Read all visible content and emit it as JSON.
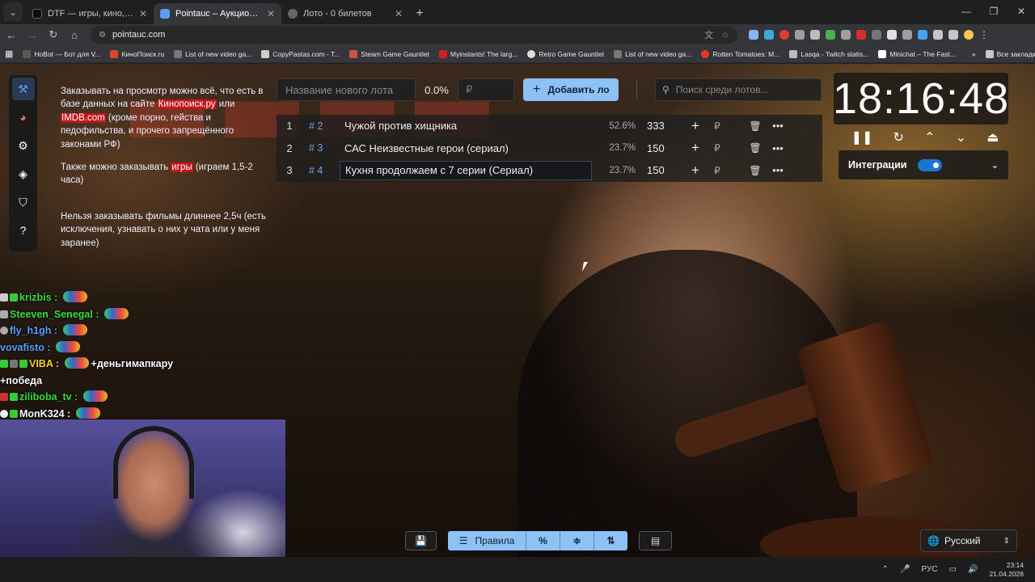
{
  "browser": {
    "tabs": [
      {
        "title": "DTF — игры, кино, сериалы, р",
        "active": false,
        "favicon_color": "#0d0d0d"
      },
      {
        "title": "Pointauc – Аукционы, лотере",
        "active": true,
        "favicon_color": "#5b9cff"
      },
      {
        "title": "Лото - 0 билетов",
        "active": false,
        "favicon_color": "#888888"
      }
    ],
    "url": "pointauc.com",
    "bookmarks": [
      {
        "label": "HoBot — Бот для V...",
        "color": "#5a5a5a"
      },
      {
        "label": "КиноПоиск.ru",
        "color": "#d94820"
      },
      {
        "label": "List of new video ga...",
        "color": "#777777"
      },
      {
        "label": "CopyPastas.com - T...",
        "color": "#cccccc"
      },
      {
        "label": "Steam Game Gauntlet",
        "color": "#c8553d"
      },
      {
        "label": "Myinstants! The larg...",
        "color": "#cc2222"
      },
      {
        "label": "Retro Game Gauntlet",
        "color": "#dddddd"
      },
      {
        "label": "List of new video ga...",
        "color": "#777777"
      },
      {
        "label": "Rotten Tomatoes: M...",
        "color": "#e03b1f"
      },
      {
        "label": "Lasqa - Twitch statis...",
        "color": "#bbbbbb"
      },
      {
        "label": "Minichat – The Fast...",
        "color": "#ffffff"
      }
    ],
    "all_bookmarks": "Все закладки"
  },
  "rules": {
    "p1_a": "Заказывать на просмотр можно всё, что есть в базе данных на сайте ",
    "p1_link1": "Кинопоиск.ру",
    "p1_b": " или ",
    "p1_link2": "IMDB.com",
    "p1_c": " (кроме порно, гейства и педофильства, и прочего запрещённого законами РФ)",
    "p2_a": "Также можно заказывать ",
    "p2_link": "игры",
    "p2_b": " (играем 1,5-2 часа)",
    "p3": "Нельзя заказывать фильмы длиннее 2,5ч (есть исключения, узнавать о них у чата или у меня заранее)"
  },
  "form": {
    "lot_name_placeholder": "Название нового лота",
    "percent": "0.0%",
    "price_placeholder": "₽",
    "add_label": "Добавить ло",
    "search_placeholder": "Поиск среди лотов..."
  },
  "lots": [
    {
      "rank": "1",
      "id": "# 2",
      "name": "Чужой против хищника",
      "percent": "52.6%",
      "amount": "333"
    },
    {
      "rank": "2",
      "id": "# 3",
      "name": "САС Неизвестные герои (сериал)",
      "percent": "23.7%",
      "amount": "150"
    },
    {
      "rank": "3",
      "id": "# 4",
      "name": "Кухня продолжаем с 7 серии (Сериал)",
      "percent": "23.7%",
      "amount": "150"
    }
  ],
  "lot_currency": "₽",
  "timer": "18:16:48",
  "integrations_label": "Интеграции",
  "integrations_enabled": true,
  "bottom": {
    "rules_label": "Правила",
    "percent_symbol": "%"
  },
  "language": "Русский",
  "chat": [
    {
      "user": "krizbis",
      "color": "#3cdc3c",
      "text": ""
    },
    {
      "user": "Steeven_Senegal",
      "color": "#3cdc3c",
      "text": ""
    },
    {
      "user": "fly_h1gh",
      "color": "#5aa0ff",
      "text": ""
    },
    {
      "user": "vovafisto",
      "color": "#5aa0ff",
      "text": ""
    },
    {
      "user": "VIBA",
      "color": "#ffd21e",
      "text": "+деньгимапкару"
    },
    {
      "user": "",
      "color": "#ffffff",
      "text": "+победа"
    },
    {
      "user": "ziliboba_tv",
      "color": "#3cdc3c",
      "text": ""
    },
    {
      "user": "MonK324",
      "color": "#ffffff",
      "text": ""
    }
  ],
  "taskbar": {
    "lang": "РУС",
    "time": "23:14",
    "date": "21.04.2026"
  }
}
